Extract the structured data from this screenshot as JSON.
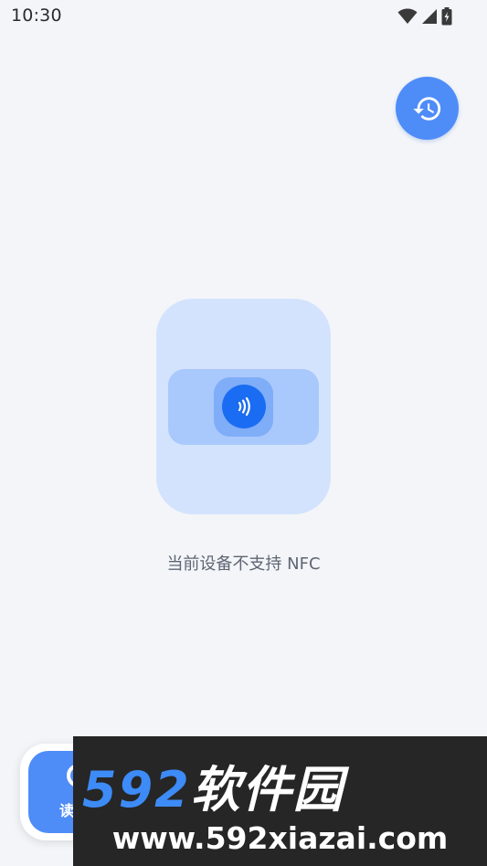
{
  "status_bar": {
    "time": "10:30",
    "icons": [
      "wifi-icon",
      "signal-icon",
      "battery-charging-icon"
    ]
  },
  "history_button": {
    "icon": "history-icon"
  },
  "illustration": {
    "icon": "nfc-icon"
  },
  "message": "当前设备不支持 NFC",
  "read_button": {
    "label": "读"
  },
  "watermark": {
    "brand_number": "592",
    "brand_text": "软件园",
    "url": "www.592xiazai.com"
  },
  "colors": {
    "accent": "#4e8cf8",
    "background": "#f3f5f9",
    "nfc_blue": "#1a6cf2"
  }
}
